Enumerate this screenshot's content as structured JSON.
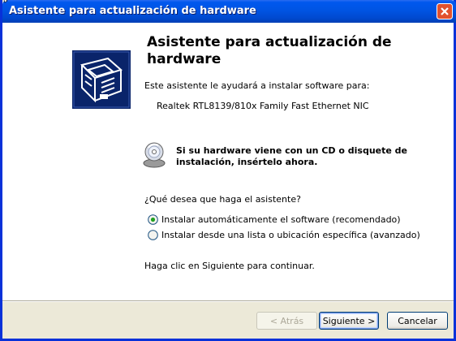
{
  "window": {
    "title": "Asistente para actualización de hardware",
    "close_icon": "close-x-icon"
  },
  "icons": {
    "wizard": "hardware-card-icon",
    "disc": "cd-disc-icon"
  },
  "content": {
    "heading": "Asistente para actualización de hardware",
    "intro": "Este asistente le ayudará a instalar software para:",
    "device": "Realtek RTL8139/810x Family Fast Ethernet NIC",
    "cd_notice_line1": "Si su hardware viene con un CD o disquete de",
    "cd_notice_line2": "instalación, insértelo ahora.",
    "question": "¿Qué desea que haga el asistente?",
    "options": [
      {
        "label": "Instalar automáticamente el software (recomendado)",
        "selected": true
      },
      {
        "label": "Instalar desde una lista o ubicación específica (avanzado)",
        "selected": false
      }
    ],
    "continue_hint": "Haga clic en Siguiente para continuar."
  },
  "buttons": {
    "back": "< Atrás",
    "next": "Siguiente >",
    "cancel": "Cancelar"
  },
  "colors": {
    "titlebar": "#0054e3",
    "wizard_icon_bg": "#0a246a",
    "face": "#ece9d8"
  }
}
